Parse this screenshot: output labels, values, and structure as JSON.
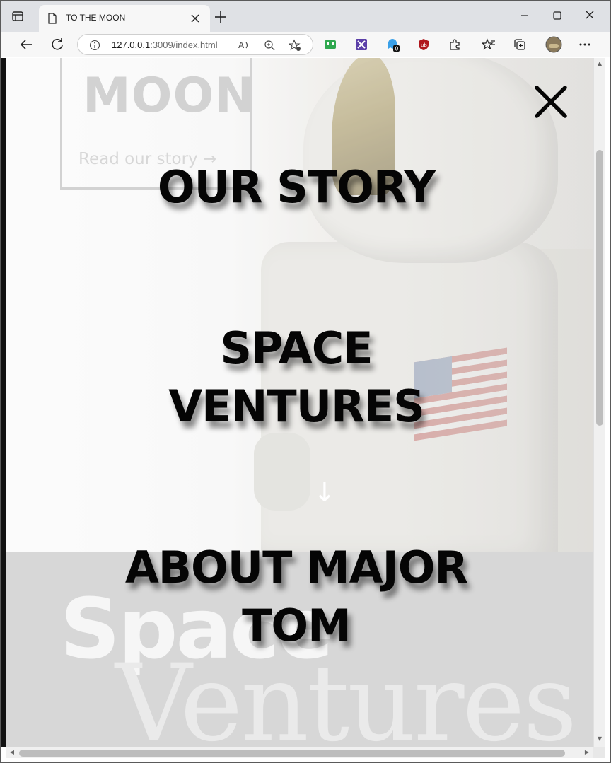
{
  "browser": {
    "tab_title": "TO THE MOON",
    "url_host": "127.0.0.1",
    "url_rest": ":3009/index.html",
    "icons": [
      "tab-actions-icon",
      "page-icon",
      "close-tab-icon",
      "new-tab-icon",
      "minimize-icon",
      "maximize-icon",
      "close-window-icon",
      "back-icon",
      "refresh-icon",
      "info-icon",
      "read-aloud-icon",
      "zoom-icon",
      "add-favorite-icon",
      "extension-icons",
      "extensions-icon",
      "favorites-icon",
      "collections-icon",
      "profile-avatar",
      "more-icon"
    ],
    "badge_count": "0"
  },
  "page": {
    "logo_text": "MOON",
    "story_link": "Read our story →",
    "scroll_arrow": "↓",
    "space_text": "Space",
    "ventures_text": "Ventures"
  },
  "menu": {
    "items": [
      "OUR STORY",
      "SPACE VENTURES",
      "ABOUT MAJOR TOM"
    ],
    "close_label": "close-menu"
  },
  "colors": {
    "menu_text": "#050505",
    "lower_band": "#cfcfcf"
  }
}
